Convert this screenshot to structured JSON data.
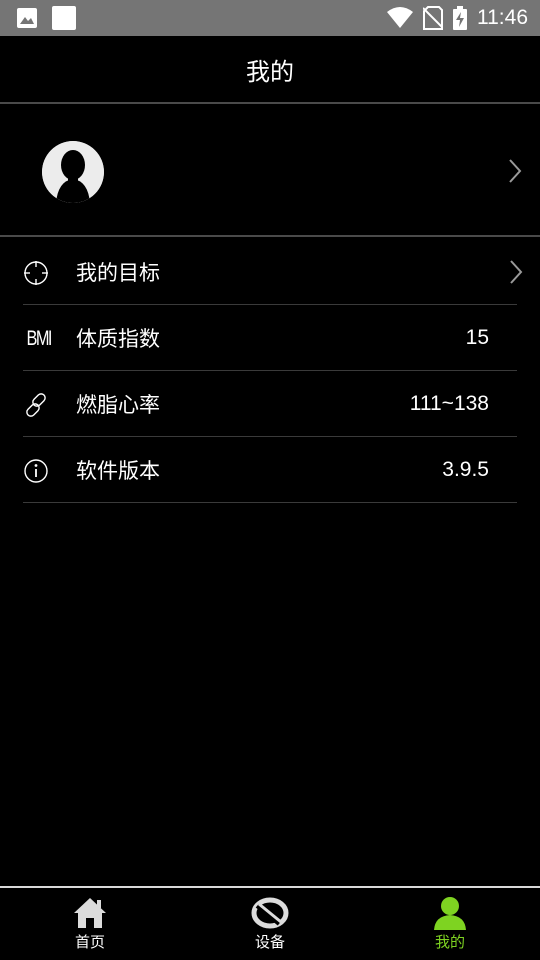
{
  "status_bar": {
    "time": "11:46"
  },
  "header": {
    "title": "我的"
  },
  "menu": {
    "items": [
      {
        "label": "我的目标",
        "value": "",
        "icon": "target-icon"
      },
      {
        "label": "体质指数",
        "value": "15",
        "icon": "bmi-icon",
        "icon_text": "BMI"
      },
      {
        "label": "燃脂心率",
        "value": "111~138",
        "icon": "link-icon"
      },
      {
        "label": "软件版本",
        "value": "3.9.5",
        "icon": "info-icon"
      }
    ]
  },
  "tabs": [
    {
      "label": "首页",
      "icon": "home-icon",
      "active": false
    },
    {
      "label": "设备",
      "icon": "device-icon",
      "active": false
    },
    {
      "label": "我的",
      "icon": "person-icon",
      "active": true
    }
  ],
  "colors": {
    "accent": "#7ed321",
    "statusbar": "#757575",
    "divider": "#4a4a4a"
  }
}
